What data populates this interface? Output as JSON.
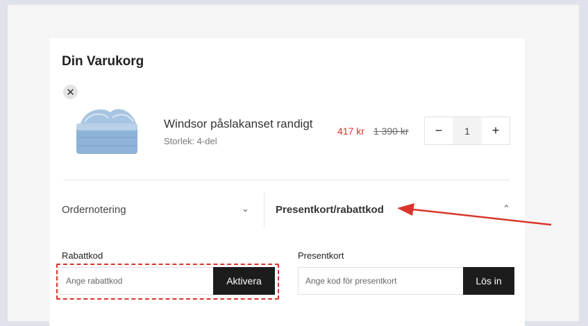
{
  "cart": {
    "title": "Din Varukorg"
  },
  "item": {
    "remove_icon": "close-icon",
    "name": "Windsor påslakanset randigt",
    "variant": "Storlek: 4-del",
    "price_sale": "417 kr",
    "price_original": "1 390 kr",
    "quantity": "1",
    "decrement_label": "−",
    "increment_label": "+"
  },
  "accordions": {
    "order_note": "Ordernotering",
    "gift_discount": "Presentkort/rabattkod",
    "collapsed_icon": "chevron-down-icon",
    "expanded_icon": "chevron-up-icon"
  },
  "discount": {
    "label": "Rabattkod",
    "placeholder": "Ange rabattkod",
    "button": "Aktivera"
  },
  "giftcard": {
    "label": "Presentkort",
    "placeholder": "Ange kod för presentkort",
    "button": "Lös in"
  },
  "colors": {
    "sale_price": "#d9352b",
    "annotation": "#d9352b",
    "button_bg": "#1c1c1c"
  }
}
